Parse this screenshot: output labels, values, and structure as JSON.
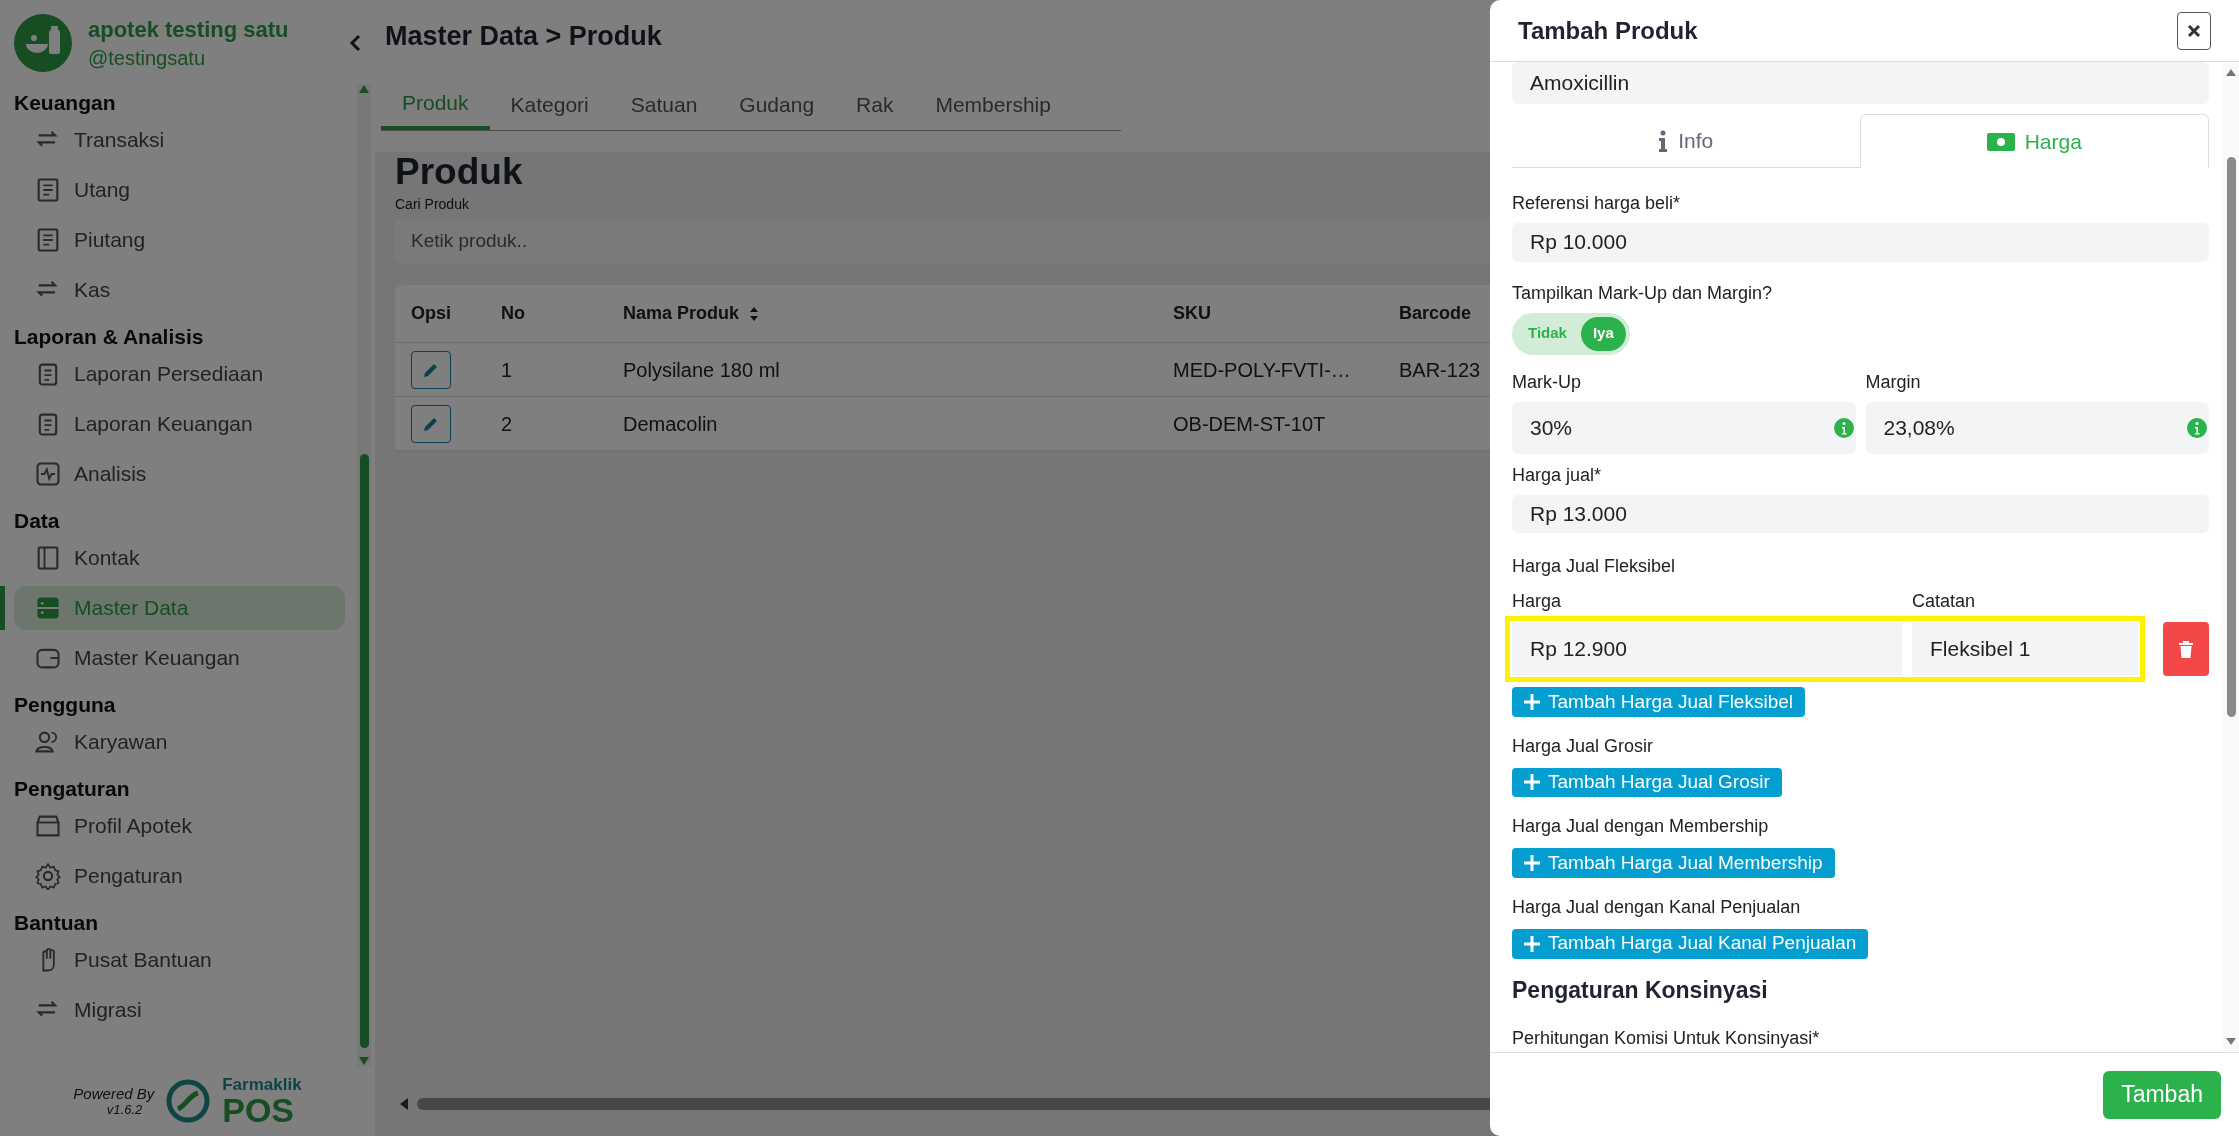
{
  "sidebar": {
    "pharmacy_name": "apotek testing satu",
    "handle": "@testingsatu",
    "sections": [
      {
        "title": "Keuangan",
        "items": [
          {
            "label": "Transaksi",
            "selected": false
          },
          {
            "label": "Utang",
            "selected": false
          },
          {
            "label": "Piutang",
            "selected": false
          },
          {
            "label": "Kas",
            "selected": false
          }
        ]
      },
      {
        "title": "Laporan & Analisis",
        "items": [
          {
            "label": "Laporan Persediaan",
            "selected": false
          },
          {
            "label": "Laporan Keuangan",
            "selected": false
          },
          {
            "label": "Analisis",
            "selected": false
          }
        ]
      },
      {
        "title": "Data",
        "items": [
          {
            "label": "Kontak",
            "selected": false
          },
          {
            "label": "Master Data",
            "selected": true
          },
          {
            "label": "Master Keuangan",
            "selected": false
          }
        ]
      },
      {
        "title": "Pengguna",
        "items": [
          {
            "label": "Karyawan",
            "selected": false
          }
        ]
      },
      {
        "title": "Pengaturan",
        "items": [
          {
            "label": "Profil Apotek",
            "selected": false
          },
          {
            "label": "Pengaturan",
            "selected": false
          }
        ]
      },
      {
        "title": "Bantuan",
        "items": [
          {
            "label": "Pusat Bantuan",
            "selected": false
          },
          {
            "label": "Migrasi",
            "selected": false
          }
        ]
      }
    ],
    "powered_by": "Powered By",
    "version": "v1.6.2",
    "brand_top": "Farmaklik",
    "brand_bottom": "POS"
  },
  "main": {
    "breadcrumb": "Master Data > Produk",
    "tabs": [
      {
        "label": "Produk",
        "selected": true
      },
      {
        "label": "Kategori",
        "selected": false
      },
      {
        "label": "Satuan",
        "selected": false
      },
      {
        "label": "Gudang",
        "selected": false
      },
      {
        "label": "Rak",
        "selected": false
      },
      {
        "label": "Membership",
        "selected": false
      }
    ],
    "heading": "Produk",
    "search_label": "Cari Produk",
    "search": {
      "placeholder": "Ketik produk.."
    },
    "table": {
      "columns": [
        {
          "label": "Opsi",
          "sortable": false
        },
        {
          "label": "No",
          "sortable": false
        },
        {
          "label": "Nama Produk",
          "sortable": true
        },
        {
          "label": "SKU",
          "sortable": false
        },
        {
          "label": "Barcode",
          "sortable": false
        }
      ],
      "rows": [
        {
          "no": "1",
          "name": "Polysilane 180 ml",
          "sku": "MED-POLY-FVTI-…",
          "barcode": "BAR-123"
        },
        {
          "no": "2",
          "name": "Demacolin",
          "sku": "OB-DEM-ST-10T"
        }
      ]
    }
  },
  "modal": {
    "title": "Tambah Produk",
    "top_field": {
      "value": "Amoxicillin"
    },
    "tabs": [
      {
        "label": "Info",
        "selected": false
      },
      {
        "label": "Harga",
        "selected": true
      }
    ],
    "purchase_ref": {
      "label": "Referensi harga beli*",
      "value": "Rp 10.000"
    },
    "markup_toggle": {
      "label": "Tampilkan Mark-Up dan Margin?",
      "options": [
        {
          "label": "Tidak",
          "selected": false
        },
        {
          "label": "Iya",
          "selected": true
        }
      ]
    },
    "markup": {
      "label": "Mark-Up",
      "value": "30%"
    },
    "margin": {
      "label": "Margin",
      "value": "23,08%"
    },
    "sell_price": {
      "label": "Harga jual*",
      "value": "Rp 13.000"
    },
    "flexible": {
      "title": "Harga Jual Fleksibel",
      "price_label": "Harga",
      "note_label": "Catatan",
      "rows": [
        {
          "price": "Rp 12.900",
          "note": "Fleksibel 1",
          "highlighted": true
        }
      ],
      "add_button": "Tambah Harga Jual Fleksibel"
    },
    "price_sections": [
      {
        "label": "Harga Jual Grosir",
        "button": "Tambah Harga Jual Grosir"
      },
      {
        "label": "Harga Jual dengan Membership",
        "button": "Tambah Harga Jual Membership"
      },
      {
        "label": "Harga Jual dengan Kanal Penjualan",
        "button": "Tambah Harga Jual Kanal Penjualan"
      }
    ],
    "consignment": {
      "heading": "Pengaturan Konsinyasi",
      "label": "Perhitungan Komisi Untuk Konsinyasi*"
    },
    "submit": "Tambah"
  }
}
